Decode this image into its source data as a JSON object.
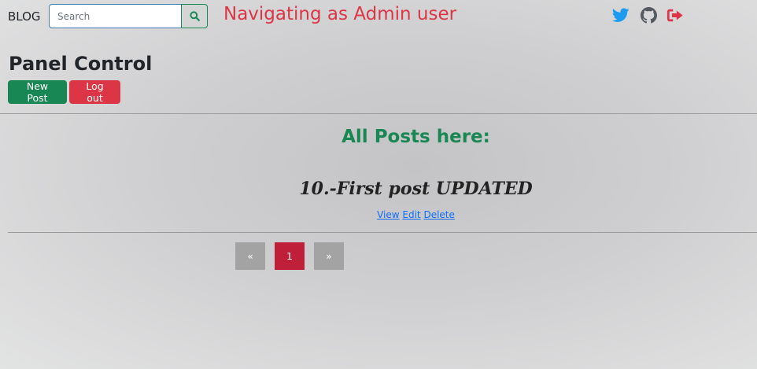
{
  "navbar": {
    "brand": "BLOG",
    "search_placeholder": "Search",
    "heading": "Navigating as Admin user",
    "social_icons": [
      "twitter-icon",
      "github-icon",
      "logout-icon"
    ]
  },
  "panel": {
    "title": "Panel Control",
    "new_post_label": "New Post",
    "logout_label": "Log out"
  },
  "posts": {
    "heading": "All Posts here:",
    "items": [
      {
        "title": "10.-First post UPDATED",
        "view": "View",
        "edit": "Edit",
        "delete": "Delete"
      }
    ]
  },
  "pagination": {
    "prev": "«",
    "current": "1",
    "next": "»"
  },
  "colors": {
    "green": "#198754",
    "red": "#dc3545",
    "twitter": "#1d9bf0",
    "active_page": "#c01f3a"
  }
}
